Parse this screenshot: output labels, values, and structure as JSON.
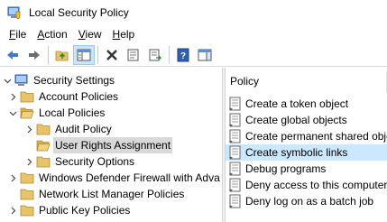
{
  "window": {
    "title": "Local Security Policy"
  },
  "menu": [
    {
      "underline": "F",
      "rest": "ile"
    },
    {
      "underline": "A",
      "rest": "ction"
    },
    {
      "underline": "V",
      "rest": "iew"
    },
    {
      "underline": "H",
      "rest": "elp"
    }
  ],
  "tree": [
    {
      "label": "Security Settings",
      "expanded": true,
      "icon": "computer-icon"
    },
    {
      "label": "Account Policies",
      "expanded": false,
      "icon": "folder-icon"
    },
    {
      "label": "Local Policies",
      "expanded": true,
      "icon": "folder-icon"
    },
    {
      "label": "Audit Policy",
      "expanded": false,
      "icon": "folder-icon"
    },
    {
      "label": "User Rights Assignment",
      "selected": true,
      "icon": "folder-open-icon"
    },
    {
      "label": "Security Options",
      "expanded": false,
      "icon": "folder-icon"
    },
    {
      "label": "Windows Defender Firewall with Adva",
      "expanded": false,
      "icon": "folder-icon"
    },
    {
      "label": "Network List Manager Policies",
      "icon": "folder-icon"
    },
    {
      "label": "Public Key Policies",
      "expanded": false,
      "icon": "folder-icon"
    }
  ],
  "list": {
    "column_header": "Policy",
    "items": [
      {
        "label": "Create a token object"
      },
      {
        "label": "Create global objects"
      },
      {
        "label": "Create permanent shared obje"
      },
      {
        "label": "Create symbolic links",
        "selected": true
      },
      {
        "label": "Debug programs"
      },
      {
        "label": "Deny access to this computer f"
      },
      {
        "label": "Deny log on as a batch job"
      }
    ]
  },
  "colors": {
    "selection_blue": "#cce8ff",
    "tree_selection_gray": "#d9d9d9",
    "folder_yellow": "#e8c36a"
  }
}
